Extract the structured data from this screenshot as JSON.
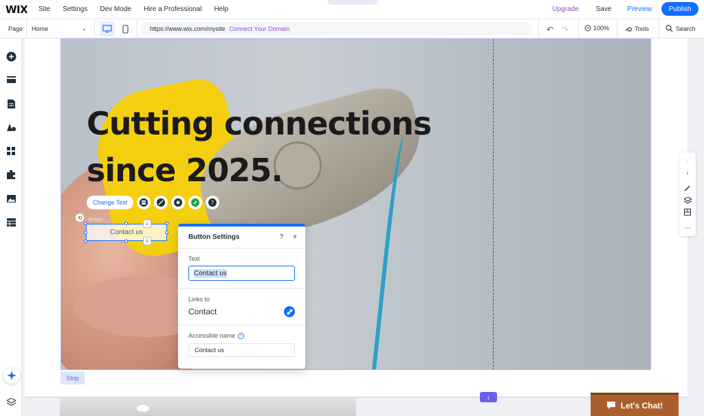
{
  "topbar": {
    "logo": "WIX",
    "menu": [
      "Site",
      "Settings",
      "Dev Mode",
      "Hire a Professional",
      "Help"
    ],
    "tab_handle": "^",
    "upgrade": "Upgrade",
    "save": "Save",
    "preview": "Preview",
    "publish": "Publish"
  },
  "secbar": {
    "page_label": "Page:",
    "page_value": "Home",
    "url": "https://www.wix.com/mysite",
    "connect_domain": "Connect Your Domain",
    "zoom": "100%",
    "tools": "Tools",
    "search": "Search"
  },
  "hero": {
    "title_line1": "Cutting connections",
    "title_line2": "since 2025."
  },
  "floating_toolbar": {
    "change_text": "Change Text"
  },
  "selected_element": {
    "type_label": "Button",
    "text": "Contact us"
  },
  "settings_panel": {
    "title": "Button Settings",
    "help": "?",
    "close": "×",
    "text_label": "Text",
    "text_value": "Contact us",
    "links_label": "Links to",
    "links_value": "Contact",
    "accessible_label": "Accessible name",
    "accessible_value": "Contact us"
  },
  "strip_tag": "Strip",
  "chat": {
    "label": "Let's Chat!"
  },
  "colors": {
    "accent": "#116dff",
    "upgrade": "#8e4bd6",
    "strip": "#5b6cd6",
    "chat": "#ad5e2d"
  }
}
